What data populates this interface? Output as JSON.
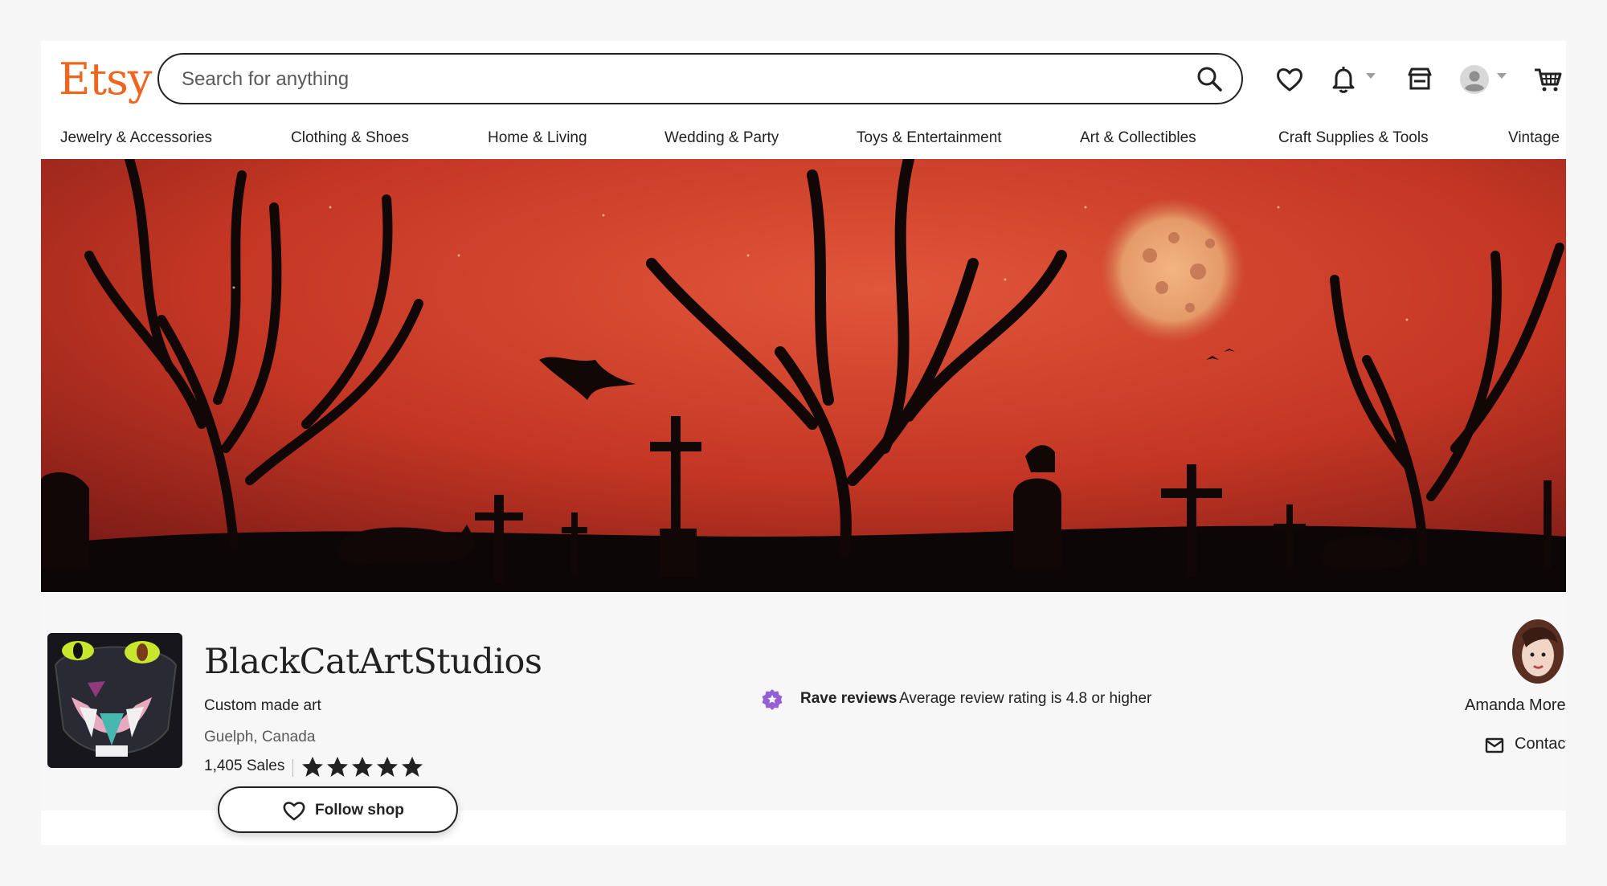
{
  "header": {
    "logo": "Etsy",
    "search_placeholder": "Search for anything"
  },
  "categories": [
    "Jewelry & Accessories",
    "Clothing & Shoes",
    "Home & Living",
    "Wedding & Party",
    "Toys & Entertainment",
    "Art & Collectibles",
    "Craft Supplies & Tools",
    "Vintage"
  ],
  "shop": {
    "name": "BlackCatArtStudios",
    "tagline": "Custom made art",
    "location": "Guelph, Canada",
    "sales": "1,405 Sales",
    "rating_stars": 5,
    "follow_label": "Follow shop",
    "rave_title": "Rave reviews",
    "rave_text": "Average review rating is 4.8 or higher",
    "owner_name": "Amanda Moreau",
    "contact_label": "Contact"
  },
  "colors": {
    "brand": "#f1641e",
    "rave_badge": "#9560d6",
    "banner_sky": "#c53a26"
  },
  "icons": [
    "search-icon",
    "heart-icon",
    "bell-icon",
    "shop-icon",
    "account-icon",
    "cart-icon",
    "star-icon",
    "mail-icon"
  ]
}
